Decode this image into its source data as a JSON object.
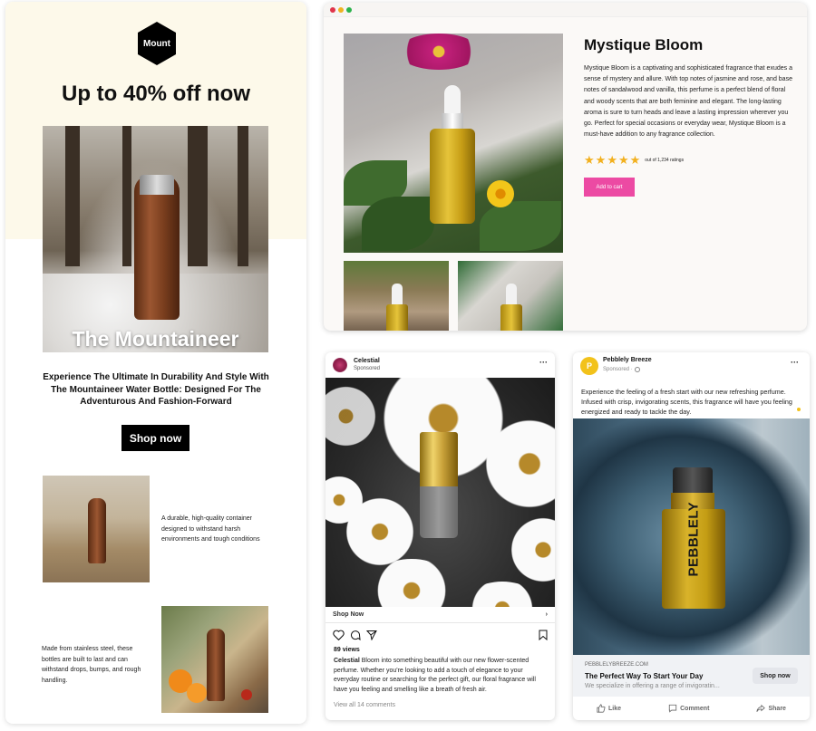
{
  "email": {
    "logo_text": "Mount",
    "headline": "Up to 40% off now",
    "hero_title": "The Mountaineer",
    "tagline": "Experience The Ultimate In Durability And Style With The Mountaineer Water Bottle: Designed For The Adventurous And Fashion-Forward",
    "cta_label": "Shop now",
    "feature_1": "A durable, high-quality container designed to withstand harsh environments and tough conditions",
    "feature_2": "Made from stainless steel, these bottles are built to last and can withstand drops, bumps, and rough handling.",
    "background_color": "#fdf9ea"
  },
  "product_page": {
    "window_dots": [
      "#e0344a",
      "#efb321",
      "#2bb24c"
    ],
    "title": "Mystique Bloom",
    "description": "Mystique Bloom is a captivating and sophisticated fragrance that exudes a sense of mystery and allure. With top notes of jasmine and rose, and base notes of sandalwood and vanilla, this perfume is a perfect blend of floral and woody scents that are both feminine and elegant. The long-lasting aroma is sure to turn heads and leave a lasting impression wherever you go. Perfect for special occasions or everyday wear, Mystique Bloom is a must-have addition to any fragrance collection.",
    "rating_stars": 5,
    "rating_max": 5,
    "ratings_text": "out of 1,234 ratings",
    "add_to_cart_label": "Add to cart",
    "accent_color": "#ec4aa3"
  },
  "instagram_ad": {
    "account_name": "Celestial",
    "sponsored_label": "Sponsored",
    "more_icon": "ellipsis-icon",
    "shop_label": "Shop Now",
    "views": "89 views",
    "caption_user": "Celestial",
    "caption_text": "Bloom into something beautiful with our new flower-scented perfume. Whether you're looking to add a touch of elegance to your everyday routine or searching for the perfect gift, our floral fragrance will have you feeling and smelling like a breath of fresh air.",
    "comments_link": "View all 14 comments"
  },
  "facebook_ad": {
    "avatar_letter": "P",
    "page_name": "Pebblely Breeze",
    "sponsored_label": "Sponsored ·",
    "post_text": "Experience the feeling of a fresh start with our new refreshing perfume. Infused with crisp, invigorating scents, this fragrance will have you feeling energized and ready to tackle the day.",
    "product_brand": "PEBBLELY",
    "link_domain": "PEBBLELYBREEZE.COM",
    "link_headline": "The Perfect Way To Start Your Day",
    "link_description": "We specialize in offering a range of invigoratin...",
    "shop_now_label": "Shop now",
    "actions": {
      "like": "Like",
      "comment": "Comment",
      "share": "Share"
    },
    "avatar_color": "#f2c21b"
  }
}
